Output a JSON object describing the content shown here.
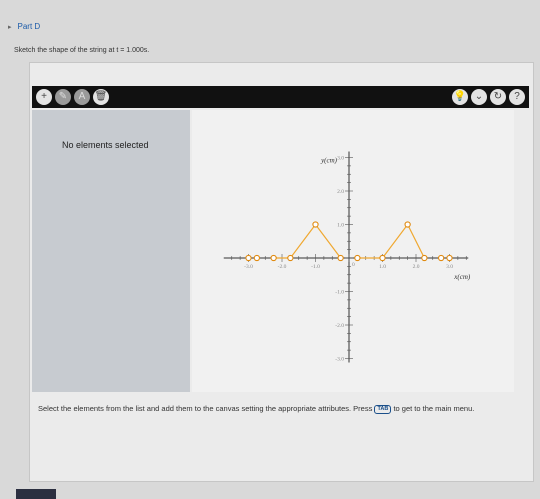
{
  "part": {
    "title": "Part D"
  },
  "prompt": "Sketch the shape of the string at t = 1.000s.",
  "toolbar": {
    "left_tools": [
      {
        "name": "add-tool-button",
        "glyph": "+"
      },
      {
        "name": "pen-tool-button",
        "glyph": "✎"
      },
      {
        "name": "label-tool-button",
        "glyph": "A"
      },
      {
        "name": "delete-tool-button",
        "glyph": "🗑"
      }
    ],
    "right_tools": [
      {
        "name": "hint-button",
        "glyph": "💡"
      },
      {
        "name": "menu-button",
        "glyph": "⌄"
      },
      {
        "name": "reset-button",
        "glyph": "↻"
      },
      {
        "name": "help-button",
        "glyph": "?"
      }
    ]
  },
  "selection_status": "No elements selected",
  "chart_data": {
    "type": "line",
    "xlabel": "x(cm)",
    "ylabel": "y(cm)",
    "xlim": [
      -3.5,
      3.5
    ],
    "ylim": [
      -3.0,
      3.0
    ],
    "x_ticks": [
      {
        "value": -3,
        "label": "-3.0"
      },
      {
        "value": -2,
        "label": "-2.0"
      },
      {
        "value": -1,
        "label": "-1.0"
      },
      {
        "value": 1,
        "label": "1.0"
      },
      {
        "value": 2,
        "label": "2.0"
      },
      {
        "value": 3,
        "label": "3.0"
      }
    ],
    "y_ticks": [
      {
        "value": 3,
        "label": "3.0"
      },
      {
        "value": 2,
        "label": "2.0"
      },
      {
        "value": 1,
        "label": "1.0"
      },
      {
        "value": -1,
        "label": "-1.0"
      },
      {
        "value": -2,
        "label": "-2.0"
      },
      {
        "value": -3,
        "label": "-3.0"
      }
    ],
    "origin_label": "0",
    "segments": [
      {
        "x": [
          -2.25,
          -1.75,
          -1.0,
          -0.25
        ],
        "y": [
          0,
          0,
          1.0,
          0
        ]
      },
      {
        "x": [
          0.25,
          1.0,
          1.75,
          2.25
        ],
        "y": [
          0,
          0,
          1.0,
          0
        ]
      }
    ],
    "markers": [
      {
        "x": -3.0,
        "y": 0
      },
      {
        "x": -2.75,
        "y": 0
      },
      {
        "x": -2.25,
        "y": 0
      },
      {
        "x": -1.75,
        "y": 0
      },
      {
        "x": -1.0,
        "y": 1.0
      },
      {
        "x": -0.25,
        "y": 0
      },
      {
        "x": 0.25,
        "y": 0
      },
      {
        "x": 1.0,
        "y": 0
      },
      {
        "x": 1.75,
        "y": 1.0
      },
      {
        "x": 2.25,
        "y": 0
      },
      {
        "x": 2.75,
        "y": 0
      },
      {
        "x": 3.0,
        "y": 0
      }
    ],
    "line_color": "#f0a830",
    "marker_color": "#e08a10"
  },
  "instructions": {
    "text_before": "Select the elements from the list and add them to the canvas setting the appropriate attributes. Press",
    "key": "TAB",
    "text_after": "to get to the main menu."
  }
}
